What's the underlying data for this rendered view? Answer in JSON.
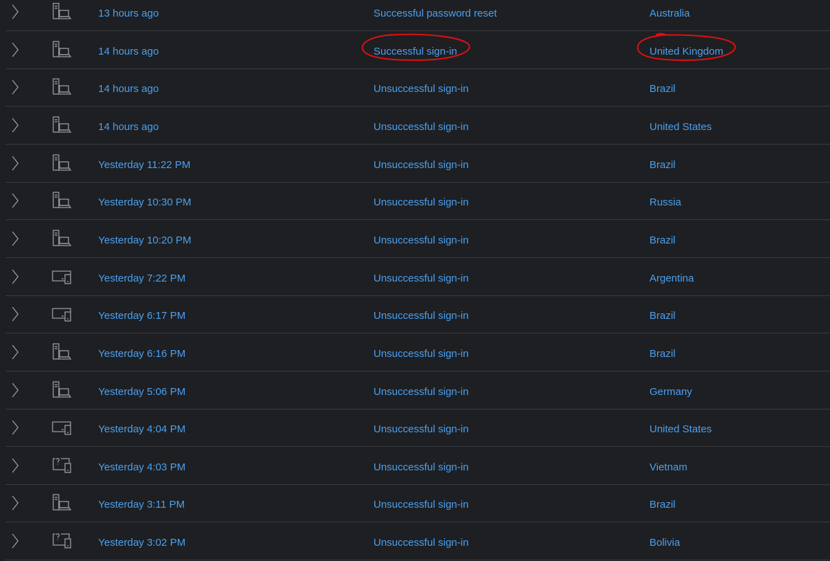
{
  "colors": {
    "background": "#1e1f22",
    "divider": "#3a3b3e",
    "link_text": "#4aa0f0",
    "icon_stroke": "#9a9ca1",
    "annotation": "#e01010"
  },
  "activity": {
    "rows": [
      {
        "time": "13 hours ago",
        "activity": "Successful password reset",
        "location": "Australia",
        "device_icon": "desktop-computer-icon"
      },
      {
        "time": "14 hours ago",
        "activity": "Successful sign-in",
        "location": "United Kingdom",
        "device_icon": "desktop-computer-icon",
        "highlighted": true
      },
      {
        "time": "14 hours ago",
        "activity": "Unsuccessful sign-in",
        "location": "Brazil",
        "device_icon": "desktop-computer-icon"
      },
      {
        "time": "14 hours ago",
        "activity": "Unsuccessful sign-in",
        "location": "United States",
        "device_icon": "desktop-computer-icon"
      },
      {
        "time": "Yesterday 11:22 PM",
        "activity": "Unsuccessful sign-in",
        "location": "Brazil",
        "device_icon": "desktop-computer-icon"
      },
      {
        "time": "Yesterday 10:30 PM",
        "activity": "Unsuccessful sign-in",
        "location": "Russia",
        "device_icon": "desktop-computer-icon"
      },
      {
        "time": "Yesterday 10:20 PM",
        "activity": "Unsuccessful sign-in",
        "location": "Brazil",
        "device_icon": "desktop-computer-icon"
      },
      {
        "time": "Yesterday 7:22 PM",
        "activity": "Unsuccessful sign-in",
        "location": "Argentina",
        "device_icon": "tablet-phone-icon"
      },
      {
        "time": "Yesterday 6:17 PM",
        "activity": "Unsuccessful sign-in",
        "location": "Brazil",
        "device_icon": "tablet-phone-icon"
      },
      {
        "time": "Yesterday 6:16 PM",
        "activity": "Unsuccessful sign-in",
        "location": "Brazil",
        "device_icon": "desktop-computer-icon"
      },
      {
        "time": "Yesterday 5:06 PM",
        "activity": "Unsuccessful sign-in",
        "location": "Germany",
        "device_icon": "desktop-computer-icon"
      },
      {
        "time": "Yesterday 4:04 PM",
        "activity": "Unsuccessful sign-in",
        "location": "United States",
        "device_icon": "tablet-phone-icon"
      },
      {
        "time": "Yesterday 4:03 PM",
        "activity": "Unsuccessful sign-in",
        "location": "Vietnam",
        "device_icon": "unknown-device-icon"
      },
      {
        "time": "Yesterday 3:11 PM",
        "activity": "Unsuccessful sign-in",
        "location": "Brazil",
        "device_icon": "desktop-computer-icon"
      },
      {
        "time": "Yesterday 3:02 PM",
        "activity": "Unsuccessful sign-in",
        "location": "Bolivia",
        "device_icon": "unknown-device-icon"
      }
    ]
  }
}
